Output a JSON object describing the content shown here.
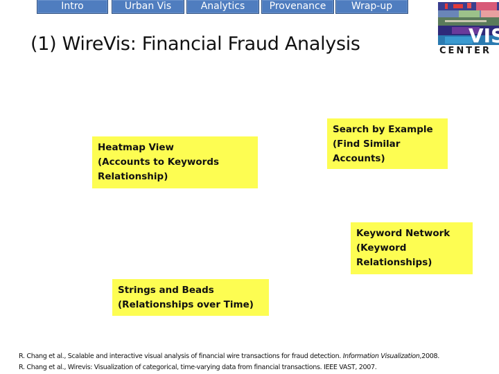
{
  "nav": {
    "tabs": [
      {
        "label": "Intro"
      },
      {
        "label": "Urban Vis"
      },
      {
        "label": "Analytics"
      },
      {
        "label": "Provenance"
      },
      {
        "label": "Wrap-up"
      }
    ],
    "colors": {
      "tab_fill": "#4f7dbf",
      "tab_border": "#2e4f80",
      "tab_text": "#ffffff"
    }
  },
  "slide": {
    "title": "(1) WireVis: Financial Fraud Analysis",
    "logo": {
      "icon": "vis-center-logo",
      "text_top": "VIS",
      "text_bottom": "CENTER"
    },
    "callout_color": "#fdfd52",
    "callouts": {
      "heatmap": {
        "lines": [
          "Heatmap View",
          "(Accounts to Keywords",
          "Relationship)"
        ]
      },
      "search": {
        "lines": [
          "Search by Example",
          "(Find Similar",
          "Accounts)"
        ]
      },
      "keyword": {
        "lines": [
          "Keyword Network",
          "(Keyword",
          "Relationships)"
        ]
      },
      "strings": {
        "lines": [
          "Strings and Beads",
          "(Relationships over Time)"
        ]
      }
    },
    "references": [
      {
        "text": "R. Chang et al., Scalable and interactive visual analysis of financial wire transactions for fraud detection. ",
        "venue": "Information Visualization",
        "suffix": ",2008."
      },
      {
        "text": "R. Chang et al., Wirevis: Visualization of categorical, time-varying data from financial transactions. IEEE VAST, 2007.",
        "venue": "",
        "suffix": ""
      }
    ]
  }
}
